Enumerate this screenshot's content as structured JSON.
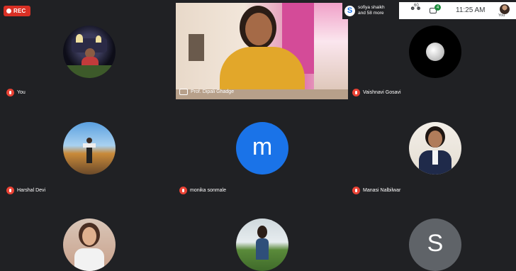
{
  "recording": {
    "label": "REC"
  },
  "topbar": {
    "notification": {
      "line1": "sofiya shaikh",
      "line2": "and 58 more",
      "logo_letter": "S"
    },
    "people_icon": "people-icon",
    "people_count": "60",
    "chat_badge": "4",
    "time": "11:25 AM",
    "self_label": "You"
  },
  "participants": [
    {
      "name": "You",
      "avatar": "night-palace-photo",
      "muted": true
    },
    {
      "name": "Prof. Dipali Ghadge",
      "avatar": "live-video",
      "muted": false,
      "presenter": true
    },
    {
      "name": "Vaishnavi Gosavi",
      "avatar": "moon-photo",
      "muted": true
    },
    {
      "name": "Harshal Devi",
      "avatar": "outdoor-pose-photo",
      "muted": true
    },
    {
      "name": "monika sonmale",
      "avatar": "letter",
      "letter": "m",
      "color": "#1a73e8",
      "muted": true
    },
    {
      "name": "Manasi Nalbilwar",
      "avatar": "portrait-photo",
      "muted": true
    },
    {
      "name": "",
      "avatar": "portrait-photo-2",
      "muted": false
    },
    {
      "name": "",
      "avatar": "landscape-photo",
      "muted": false
    },
    {
      "name": "",
      "avatar": "letter",
      "letter": "S",
      "color": "#5f6368",
      "muted": false
    }
  ],
  "colors": {
    "background": "#202124",
    "rec": "#d93025",
    "mic_off": "#ea4335",
    "chat_badge": "#1e8e3e"
  }
}
